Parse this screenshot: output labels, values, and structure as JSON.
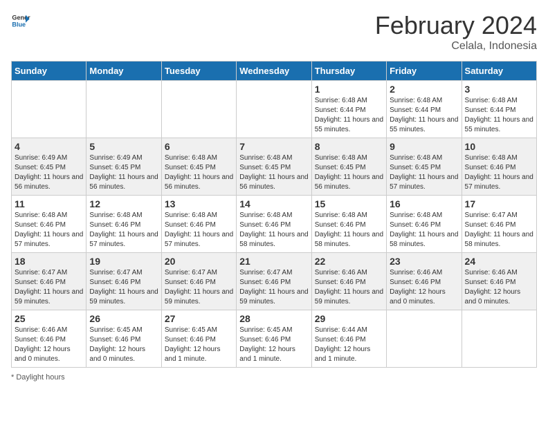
{
  "logo": {
    "general": "General",
    "blue": "Blue"
  },
  "title": "February 2024",
  "location": "Celala, Indonesia",
  "days_of_week": [
    "Sunday",
    "Monday",
    "Tuesday",
    "Wednesday",
    "Thursday",
    "Friday",
    "Saturday"
  ],
  "footer": "Daylight hours",
  "weeks": [
    [
      {
        "day": "",
        "info": ""
      },
      {
        "day": "",
        "info": ""
      },
      {
        "day": "",
        "info": ""
      },
      {
        "day": "",
        "info": ""
      },
      {
        "day": "1",
        "info": "Sunrise: 6:48 AM\nSunset: 6:44 PM\nDaylight: 11 hours and 55 minutes."
      },
      {
        "day": "2",
        "info": "Sunrise: 6:48 AM\nSunset: 6:44 PM\nDaylight: 11 hours and 55 minutes."
      },
      {
        "day": "3",
        "info": "Sunrise: 6:48 AM\nSunset: 6:44 PM\nDaylight: 11 hours and 55 minutes."
      }
    ],
    [
      {
        "day": "4",
        "info": "Sunrise: 6:49 AM\nSunset: 6:45 PM\nDaylight: 11 hours and 56 minutes."
      },
      {
        "day": "5",
        "info": "Sunrise: 6:49 AM\nSunset: 6:45 PM\nDaylight: 11 hours and 56 minutes."
      },
      {
        "day": "6",
        "info": "Sunrise: 6:48 AM\nSunset: 6:45 PM\nDaylight: 11 hours and 56 minutes."
      },
      {
        "day": "7",
        "info": "Sunrise: 6:48 AM\nSunset: 6:45 PM\nDaylight: 11 hours and 56 minutes."
      },
      {
        "day": "8",
        "info": "Sunrise: 6:48 AM\nSunset: 6:45 PM\nDaylight: 11 hours and 56 minutes."
      },
      {
        "day": "9",
        "info": "Sunrise: 6:48 AM\nSunset: 6:45 PM\nDaylight: 11 hours and 57 minutes."
      },
      {
        "day": "10",
        "info": "Sunrise: 6:48 AM\nSunset: 6:46 PM\nDaylight: 11 hours and 57 minutes."
      }
    ],
    [
      {
        "day": "11",
        "info": "Sunrise: 6:48 AM\nSunset: 6:46 PM\nDaylight: 11 hours and 57 minutes."
      },
      {
        "day": "12",
        "info": "Sunrise: 6:48 AM\nSunset: 6:46 PM\nDaylight: 11 hours and 57 minutes."
      },
      {
        "day": "13",
        "info": "Sunrise: 6:48 AM\nSunset: 6:46 PM\nDaylight: 11 hours and 57 minutes."
      },
      {
        "day": "14",
        "info": "Sunrise: 6:48 AM\nSunset: 6:46 PM\nDaylight: 11 hours and 58 minutes."
      },
      {
        "day": "15",
        "info": "Sunrise: 6:48 AM\nSunset: 6:46 PM\nDaylight: 11 hours and 58 minutes."
      },
      {
        "day": "16",
        "info": "Sunrise: 6:48 AM\nSunset: 6:46 PM\nDaylight: 11 hours and 58 minutes."
      },
      {
        "day": "17",
        "info": "Sunrise: 6:47 AM\nSunset: 6:46 PM\nDaylight: 11 hours and 58 minutes."
      }
    ],
    [
      {
        "day": "18",
        "info": "Sunrise: 6:47 AM\nSunset: 6:46 PM\nDaylight: 11 hours and 59 minutes."
      },
      {
        "day": "19",
        "info": "Sunrise: 6:47 AM\nSunset: 6:46 PM\nDaylight: 11 hours and 59 minutes."
      },
      {
        "day": "20",
        "info": "Sunrise: 6:47 AM\nSunset: 6:46 PM\nDaylight: 11 hours and 59 minutes."
      },
      {
        "day": "21",
        "info": "Sunrise: 6:47 AM\nSunset: 6:46 PM\nDaylight: 11 hours and 59 minutes."
      },
      {
        "day": "22",
        "info": "Sunrise: 6:46 AM\nSunset: 6:46 PM\nDaylight: 11 hours and 59 minutes."
      },
      {
        "day": "23",
        "info": "Sunrise: 6:46 AM\nSunset: 6:46 PM\nDaylight: 12 hours and 0 minutes."
      },
      {
        "day": "24",
        "info": "Sunrise: 6:46 AM\nSunset: 6:46 PM\nDaylight: 12 hours and 0 minutes."
      }
    ],
    [
      {
        "day": "25",
        "info": "Sunrise: 6:46 AM\nSunset: 6:46 PM\nDaylight: 12 hours and 0 minutes."
      },
      {
        "day": "26",
        "info": "Sunrise: 6:45 AM\nSunset: 6:46 PM\nDaylight: 12 hours and 0 minutes."
      },
      {
        "day": "27",
        "info": "Sunrise: 6:45 AM\nSunset: 6:46 PM\nDaylight: 12 hours and 1 minute."
      },
      {
        "day": "28",
        "info": "Sunrise: 6:45 AM\nSunset: 6:46 PM\nDaylight: 12 hours and 1 minute."
      },
      {
        "day": "29",
        "info": "Sunrise: 6:44 AM\nSunset: 6:46 PM\nDaylight: 12 hours and 1 minute."
      },
      {
        "day": "",
        "info": ""
      },
      {
        "day": "",
        "info": ""
      }
    ]
  ]
}
